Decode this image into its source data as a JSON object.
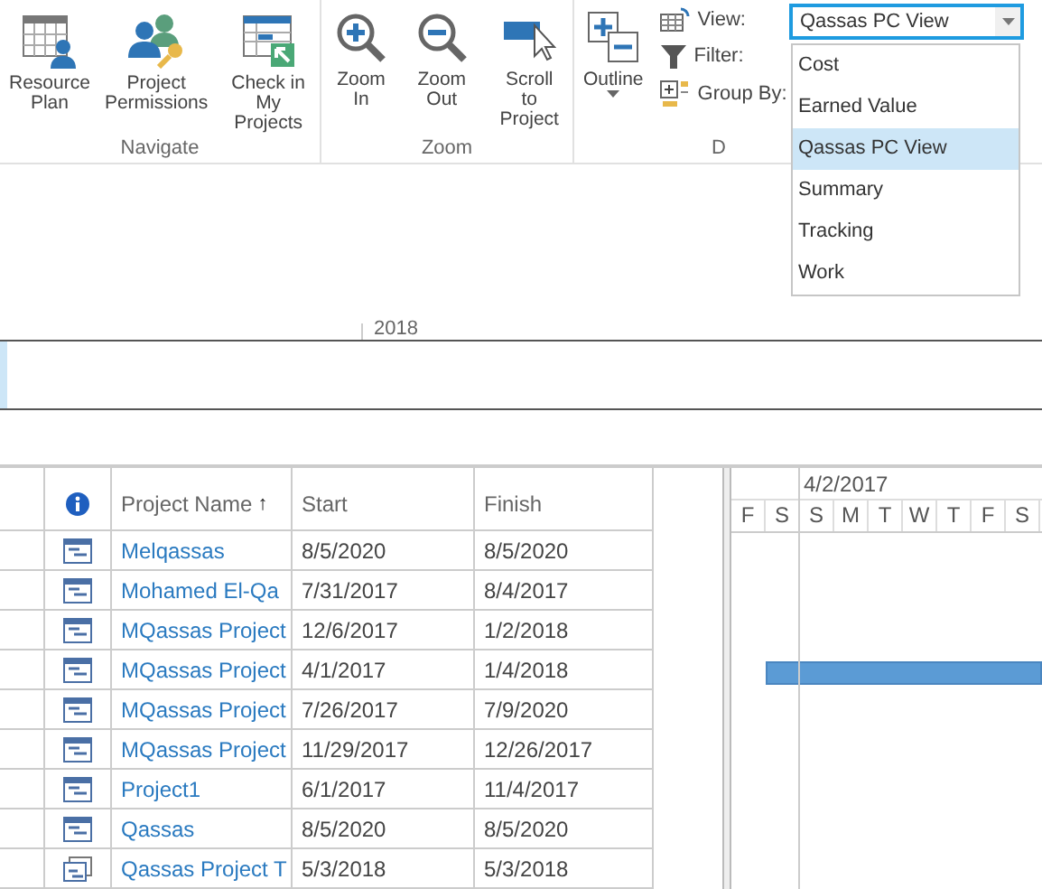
{
  "ribbon": {
    "groups": [
      {
        "label": "Navigate",
        "buttons": [
          {
            "kind": "resource",
            "label": "Resource Plan"
          },
          {
            "kind": "permissions",
            "label": "Project Permissions"
          },
          {
            "kind": "checkin",
            "label": "Check in My Projects"
          }
        ]
      },
      {
        "label": "Zoom",
        "buttons": [
          {
            "kind": "zoomin",
            "label": "Zoom In"
          },
          {
            "kind": "zoomout",
            "label": "Zoom Out"
          },
          {
            "kind": "scroll",
            "label": "Scroll to Project"
          }
        ]
      },
      {
        "label": "D",
        "buttons": [
          {
            "kind": "outline",
            "label": "Outline"
          }
        ],
        "fields": [
          {
            "kind": "view",
            "label": "View:"
          },
          {
            "kind": "filter",
            "label": "Filter:"
          },
          {
            "kind": "group",
            "label": "Group By:"
          }
        ]
      }
    ]
  },
  "view_dropdown": {
    "value": "Qassas PC View",
    "options": [
      {
        "label": "Cost",
        "selected": false
      },
      {
        "label": "Earned Value",
        "selected": false
      },
      {
        "label": "Qassas PC View",
        "selected": true
      },
      {
        "label": "Summary",
        "selected": false
      },
      {
        "label": "Tracking",
        "selected": false
      },
      {
        "label": "Work",
        "selected": false
      }
    ]
  },
  "timeline": {
    "year": "2018"
  },
  "table": {
    "columns": [
      {
        "kind": "info"
      },
      {
        "kind": "text",
        "label": "Project Name",
        "sort": "↑"
      },
      {
        "kind": "text",
        "label": "Start"
      },
      {
        "kind": "text",
        "label": "Finish"
      }
    ],
    "rows": [
      {
        "kind": "project",
        "name": "Melqassas",
        "start": "8/5/2020",
        "finish": "8/5/2020",
        "gantt_bar": false
      },
      {
        "kind": "project",
        "name": "Mohamed El-Qa",
        "start": "7/31/2017",
        "finish": "8/4/2017",
        "gantt_bar": false
      },
      {
        "kind": "project",
        "name": "MQassas Project",
        "start": "12/6/2017",
        "finish": "1/2/2018",
        "gantt_bar": false
      },
      {
        "kind": "project",
        "name": "MQassas Project",
        "start": "4/1/2017",
        "finish": "1/4/2018",
        "gantt_bar": true
      },
      {
        "kind": "project",
        "name": "MQassas Project",
        "start": "7/26/2017",
        "finish": "7/9/2020",
        "gantt_bar": false
      },
      {
        "kind": "project",
        "name": "MQassas Project",
        "start": "11/29/2017",
        "finish": "12/26/2017",
        "gantt_bar": false
      },
      {
        "kind": "project",
        "name": "Project1",
        "start": "6/1/2017",
        "finish": "11/4/2017",
        "gantt_bar": false
      },
      {
        "kind": "project",
        "name": "Qassas",
        "start": "8/5/2020",
        "finish": "8/5/2020",
        "gantt_bar": false
      },
      {
        "kind": "other",
        "name": "Qassas Project T",
        "start": "5/3/2018",
        "finish": "5/3/2018",
        "gantt_bar": false
      }
    ]
  },
  "gantt": {
    "week": "4/2/2017",
    "days": [
      "F",
      "S",
      "S",
      "M",
      "T",
      "W",
      "T",
      "F",
      "S"
    ]
  }
}
